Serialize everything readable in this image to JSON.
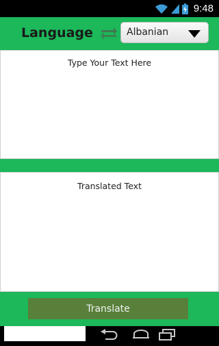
{
  "status_bar": {
    "time": "9:48",
    "icons": [
      "wifi-icon",
      "signal-icon",
      "battery-icon"
    ]
  },
  "header": {
    "title": "Language",
    "swap_icon": "swap-arrows-icon",
    "language_select": {
      "value": "Albanian",
      "icon": "dropdown-triangle-icon"
    }
  },
  "input_panel": {
    "placeholder": "Type Your Text Here"
  },
  "output_panel": {
    "label": "Translated Text"
  },
  "footer": {
    "translate_label": "Translate"
  },
  "nav_bar": {
    "icons": [
      "back-icon",
      "home-icon",
      "recent-apps-icon"
    ]
  },
  "colors": {
    "primary_green": "#1cb85a",
    "button_green": "#58803a",
    "panel_bg": "#ffffff"
  }
}
